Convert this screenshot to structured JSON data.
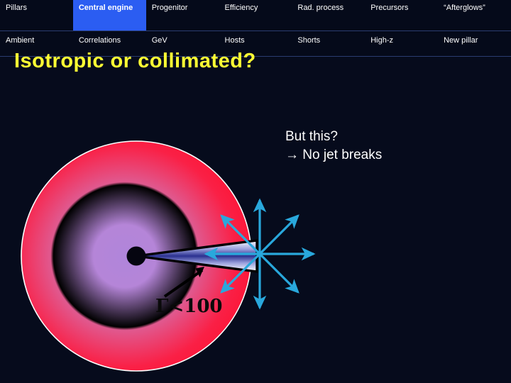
{
  "slide": {
    "title": "Isotropic or collimated?",
    "title_color": "#ffff33",
    "background_color": "#060b1c"
  },
  "nav": {
    "active_index": 1,
    "active_color": "#2b5df2",
    "row_top": [
      "Pillars",
      "Central engine",
      "Progenitor",
      "Efficiency",
      "Rad. process",
      "Precursors",
      "“Afterglows”"
    ],
    "row_bottom": [
      "Ambient",
      "Correlations",
      "GeV",
      "Hosts",
      "Shorts",
      "High-z",
      "New pillar"
    ]
  },
  "annotation": {
    "line1": "But this?",
    "line2": "→ No jet breaks",
    "color": "#ffffff"
  },
  "figure": {
    "fireball_label": "isotropic-fireball-sphere",
    "fireball_center_color": "#b585d8",
    "fireball_edge_color": "#fa1a3c",
    "fireball_outline_color": "#ffffff",
    "engine_label": "central-engine-core",
    "engine_color": "#050510",
    "jet_outline_color": "#000000",
    "jet_fill_light": "#ffffff",
    "jet_fill_dark": "#2b3190",
    "arrows_color": "#29a8dc",
    "arrow_count": 8,
    "gamma_label": "Γ<100",
    "gamma_label_color": "#0a0a0a",
    "pointer_arrow_color": "#000000"
  }
}
